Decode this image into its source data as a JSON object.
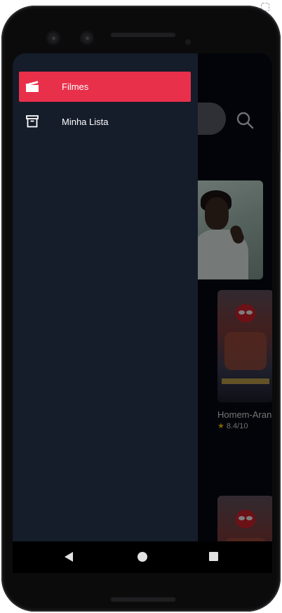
{
  "drawer": {
    "items": [
      {
        "label": "Filmes",
        "icon": "clapperboard-icon",
        "active": true
      },
      {
        "label": "Minha Lista",
        "icon": "archive-box-icon",
        "active": false
      }
    ]
  },
  "main": {
    "movie": {
      "title": "Homem-Aran",
      "rating": "8.4/10"
    }
  },
  "colors": {
    "accent": "#e8304b",
    "drawer_bg": "#151c2a",
    "screen_bg": "#050812",
    "rating_star": "#f2b300"
  }
}
